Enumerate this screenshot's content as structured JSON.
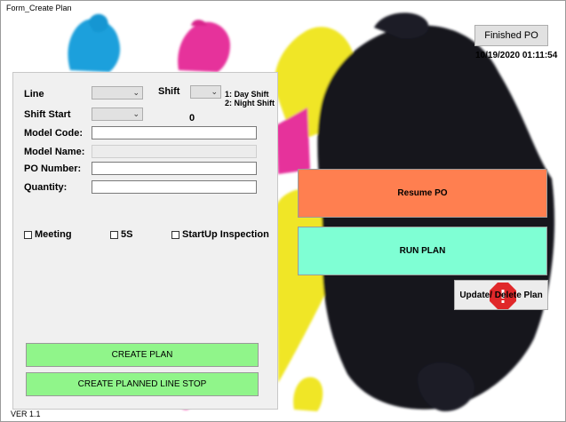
{
  "window": {
    "title": "Form_Create Plan",
    "version": "VER 1.1"
  },
  "colors": {
    "resume_bg": "#ff7f50",
    "run_bg": "#7fffd4",
    "green_bg": "#90f58a",
    "panel_bg": "#f0f0f0"
  },
  "form": {
    "line_label": "Line",
    "shift_label": "Shift",
    "shift_option_1": "1: Day Shift",
    "shift_option_2": "2: Night Shift",
    "shift_start_label": "Shift Start",
    "count_value": "0",
    "model_code_label": "Model Code:",
    "model_name_label": "Model Name:",
    "po_number_label": "PO Number:",
    "quantity_label": "Quantity:",
    "model_code_value": "",
    "model_name_value": "",
    "po_number_value": "",
    "quantity_value": ""
  },
  "checkboxes": {
    "meeting": "Meeting",
    "five_s": "5S",
    "startup": "StartUp Inspection"
  },
  "buttons": {
    "create_plan": "CREATE PLAN",
    "create_line_stop": "CREATE PLANNED LINE STOP",
    "finished_po": "Finished PO",
    "resume_po": "Resume PO",
    "run_plan": "RUN PLAN",
    "update_delete": "Update/ Delete Plan"
  },
  "status": {
    "datetime": "10/19/2020 01:11:54"
  }
}
